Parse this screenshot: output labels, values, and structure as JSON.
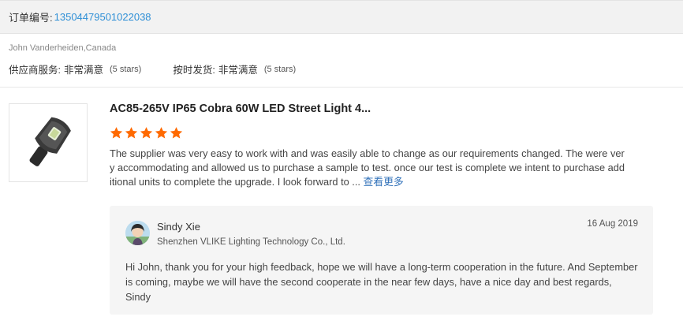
{
  "order": {
    "label": "订单编号:",
    "number": "13504479501022038"
  },
  "buyer": {
    "name": "John Vanderheiden,Canada",
    "ratings": [
      {
        "label": "供应商服务:",
        "value": "非常满意",
        "note": "(5 stars)"
      },
      {
        "label": "按时发货:",
        "value": "非常满意",
        "note": "(5 stars)"
      }
    ]
  },
  "product": {
    "image_icon": "street-light-image",
    "title": "AC85-265V IP65 Cobra 60W LED Street Light 4...",
    "rating": 5,
    "star_color": "#ff6a00"
  },
  "review": {
    "text": "The supplier was very easy to work with and was easily able to change as our requirements changed. The were very accommodating and allowed us to purchase a sample to test. once our test is complete we intent to purchase additional units to complete the upgrade. I look forward to ... ",
    "more_link": "查看更多"
  },
  "reply": {
    "name": "Sindy Xie",
    "company": "Shenzhen VLIKE Lighting Technology Co., Ltd.",
    "date": "16 Aug 2019",
    "text": "Hi John, thank you for your high feedback, hope we will have a long-term cooperation in the future. And September is coming, maybe we will have the second cooperate in the near few days, have a nice day and best regards, Sindy"
  }
}
